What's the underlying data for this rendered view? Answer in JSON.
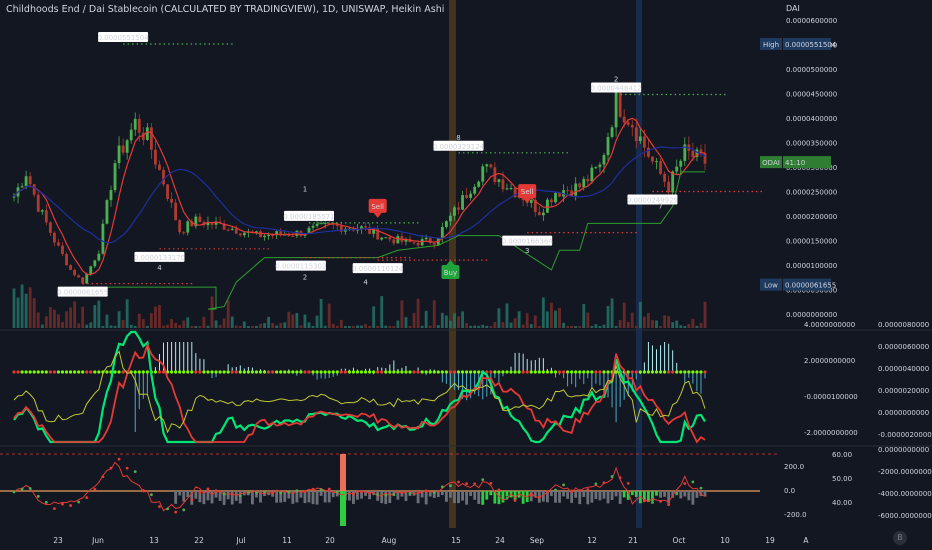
{
  "title": "Childhoods End / Dai Stablecoin (CALCULATED BY TRADINGVIEW), 1D, UNISWAP, Heikin Ashi",
  "quote_currency": "DAI",
  "colors": {
    "background": "#131722",
    "up": "#4caf50",
    "down": "#b03a2e",
    "fast_ma": "#e53935",
    "slow_ma": "#1a237e",
    "trail": "#2e9e2e",
    "price_tag": "#2e7d32",
    "high_tag": "#1e3a5f",
    "sell": "#e53935",
    "buy": "#1fa33a"
  },
  "price_tag": {
    "label": "ODAI",
    "value": "41:10"
  },
  "high_label": {
    "label": "High",
    "value": "0.0000551504"
  },
  "low_label": {
    "label": "Low",
    "value": "0.0000061655"
  },
  "signals": [
    {
      "type": "sell",
      "label": "Sell",
      "date": "2021-07-27"
    },
    {
      "type": "sell",
      "label": "Sell",
      "date": "2021-08-26"
    },
    {
      "type": "buy",
      "label": "Buy",
      "date": "2021-08-13"
    }
  ],
  "watermark": "B",
  "chart_data": [
    {
      "type": "candlestick",
      "name": "price",
      "yticks": [
        "0.0000600000",
        "0.0000550000",
        "0.0000500000",
        "0.0000450000",
        "0.0000400000",
        "0.0000350000",
        "0.0000300000",
        "0.0000250000",
        "0.0000200000",
        "0.0000150000",
        "0.0000100000",
        "0.0000050000",
        "0.0000000000"
      ],
      "ylim": [
        0,
        6e-05
      ],
      "xticks": [
        "23",
        "Jun",
        "13",
        "22",
        "Jul",
        "11",
        "20",
        "Aug",
        "15",
        "24",
        "Sep",
        "12",
        "21",
        "Oct",
        "10",
        "19",
        "A"
      ],
      "annotations": [
        {
          "text": "0.0000551504",
          "kind": "high"
        },
        {
          "text": "0.0000133170",
          "kind": "low"
        },
        {
          "text": "0.0000061655",
          "kind": "low"
        },
        {
          "text": "0.0000185571",
          "kind": "high"
        },
        {
          "text": "0.0000115302",
          "kind": "low"
        },
        {
          "text": "0.0000110124",
          "kind": "low"
        },
        {
          "text": "0.0000329124",
          "kind": "high"
        },
        {
          "text": "0.0000166364",
          "kind": "low"
        },
        {
          "text": "0.0000448412",
          "kind": "high"
        },
        {
          "text": "0.0000249929",
          "kind": "low"
        }
      ],
      "wave_labels": [
        "4",
        "1",
        "2",
        "4",
        "8",
        "3",
        "2",
        "7"
      ]
    },
    {
      "type": "oscillator",
      "name": "macd-like",
      "left_ticks": [
        "4.0000000000",
        "2.0000000000",
        "-0.0000100000",
        "-2.0000000000"
      ],
      "right_ticks": [
        "0.0000080000",
        "0.0000060000",
        "0.0000040000",
        "0.0000020000",
        "0.0000000000",
        "-0.0000020000"
      ]
    },
    {
      "type": "oscillator",
      "name": "rsi-like",
      "left_ticks": [
        "60.00",
        "200.0",
        "50.00",
        "0.0",
        "40.00",
        "-200.0"
      ],
      "right_ticks": [
        "0.0000000000",
        "-2000.0000000000",
        "-4000.0000000000",
        "-6000.0000000000"
      ]
    }
  ]
}
